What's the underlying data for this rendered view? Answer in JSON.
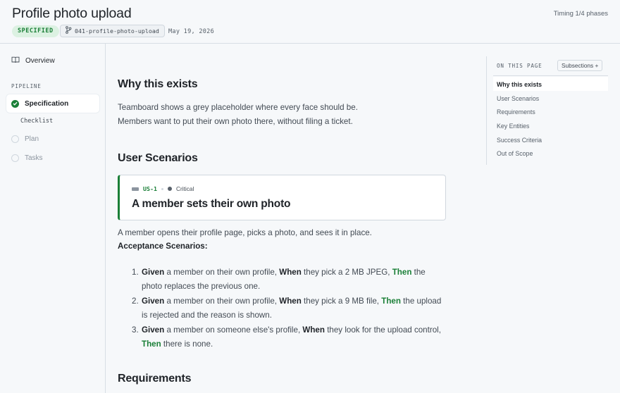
{
  "header": {
    "title": "Profile photo upload",
    "status_badge": "SPECIFIED",
    "branch": "041-profile-photo-upload",
    "date": "May 19, 2026",
    "timing": "Timing 1/4 phases"
  },
  "sidebar": {
    "overview_label": "Overview",
    "pipeline_label": "PIPELINE",
    "steps": [
      {
        "label": "Specification",
        "state": "done"
      },
      {
        "label": "Checklist",
        "state": "sub"
      },
      {
        "label": "Plan",
        "state": "pending"
      },
      {
        "label": "Tasks",
        "state": "pending"
      }
    ]
  },
  "main": {
    "why_heading": "Why this exists",
    "why_lines": [
      "Teamboard shows a grey placeholder where every face should be.",
      "Members want to put their own photo there, without filing a ticket."
    ],
    "scenarios_heading": "User Scenarios",
    "story": {
      "id": "US-1",
      "priority": "Critical",
      "title": "A member sets their own photo",
      "description": "A member opens their profile page, picks a photo, and sees it in place."
    },
    "acceptance_heading": "Acceptance Scenarios:",
    "scenarios": [
      {
        "num": "1.",
        "given_kw": "Given",
        "given": " a member on their own profile, ",
        "when_kw": "When",
        "when": " they pick a 2 MB JPEG, ",
        "then_kw": "Then",
        "then": " the photo replaces the previous one."
      },
      {
        "num": "2.",
        "given_kw": "Given",
        "given": " a member on their own profile, ",
        "when_kw": "When",
        "when": " they pick a 9 MB file, ",
        "then_kw": "Then",
        "then": " the upload is rejected and the reason is shown."
      },
      {
        "num": "3.",
        "given_kw": "Given",
        "given": " a member on someone else's profile, ",
        "when_kw": "When",
        "when": " they look for the upload control, ",
        "then_kw": "Then",
        "then": " there is none."
      }
    ],
    "requirements_heading": "Requirements"
  },
  "toc": {
    "label": "ON THIS PAGE",
    "subsections_button": "Subsections +",
    "items": [
      "Why this exists",
      "User Scenarios",
      "Requirements",
      "Key Entities",
      "Success Criteria",
      "Out of Scope"
    ],
    "active": "Why this exists"
  },
  "colors": {
    "accent_green": "#1a7f37",
    "badge_bg": "#dcf1e2"
  }
}
